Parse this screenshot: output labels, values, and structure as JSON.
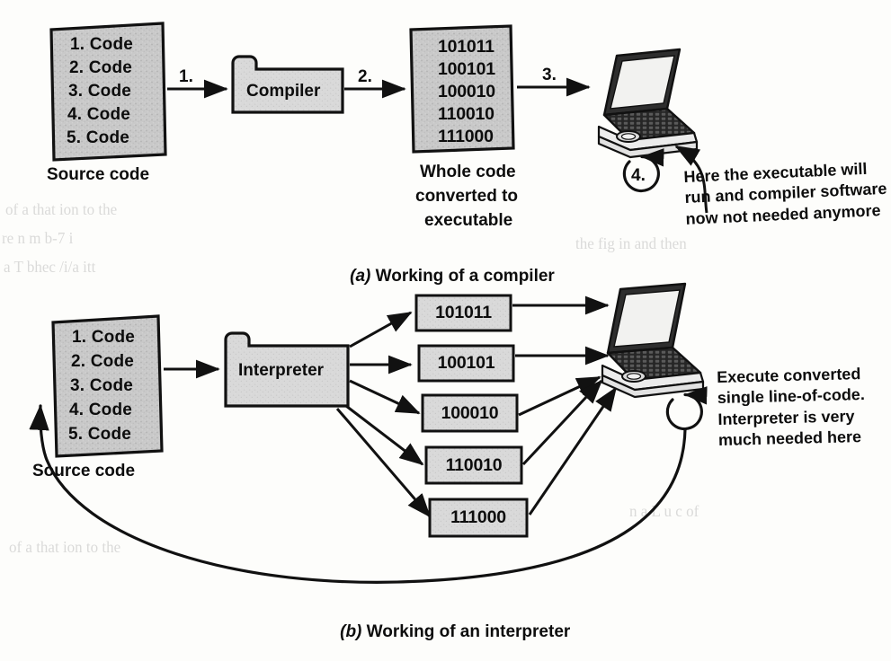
{
  "figure": {
    "title_top": "(a) Working of a compiler",
    "title_bottom": "(b) Working of an interpreter",
    "label_a": "(a)",
    "label_b": "(b)",
    "text_a": " Working of a compiler",
    "text_b": " Working of an interpreter"
  },
  "colors": {
    "box_fill": "#c9c9c9",
    "box_fill_light": "#d8d8d8",
    "stroke": "#111111",
    "paper": "#fdfdfb",
    "screen": "#f4f4f2",
    "keyboard": "#2b2b2b"
  },
  "compiler_diagram": {
    "source_code": {
      "caption": "Source code",
      "lines": [
        "1. Code",
        "2. Code",
        "3. Code",
        "4. Code",
        "5. Code"
      ]
    },
    "processor": {
      "label": "Compiler"
    },
    "executable": {
      "lines": [
        "101011",
        "100101",
        "100010",
        "110010",
        "111000"
      ],
      "caption_lines": [
        "Whole code",
        "converted to",
        "executable"
      ]
    },
    "device": {
      "name": "laptop"
    },
    "steps": [
      "1.",
      "2.",
      "3.",
      "4."
    ],
    "annotation_lines": [
      "Here the executable will",
      "run and compiler software",
      "now not needed anymore"
    ]
  },
  "interpreter_diagram": {
    "source_code": {
      "caption": "Source code",
      "lines": [
        "1. Code",
        "2. Code",
        "3. Code",
        "4. Code",
        "5. Code"
      ]
    },
    "processor": {
      "label": "Interpreter"
    },
    "executable_lines": [
      "101011",
      "100101",
      "100010",
      "110010",
      "111000"
    ],
    "device": {
      "name": "laptop"
    },
    "annotation_lines": [
      "Execute converted",
      "single line-of-code.",
      "Interpreter is very",
      "much needed here"
    ]
  },
  "ghost_text": {
    "rows": [
      "of a that ion to the",
      "re n  m  b-7   i",
      "a  T  bhec  /i/a  itt",
      "the fig  in  and then",
      "n  a   L  u  c  of"
    ]
  }
}
